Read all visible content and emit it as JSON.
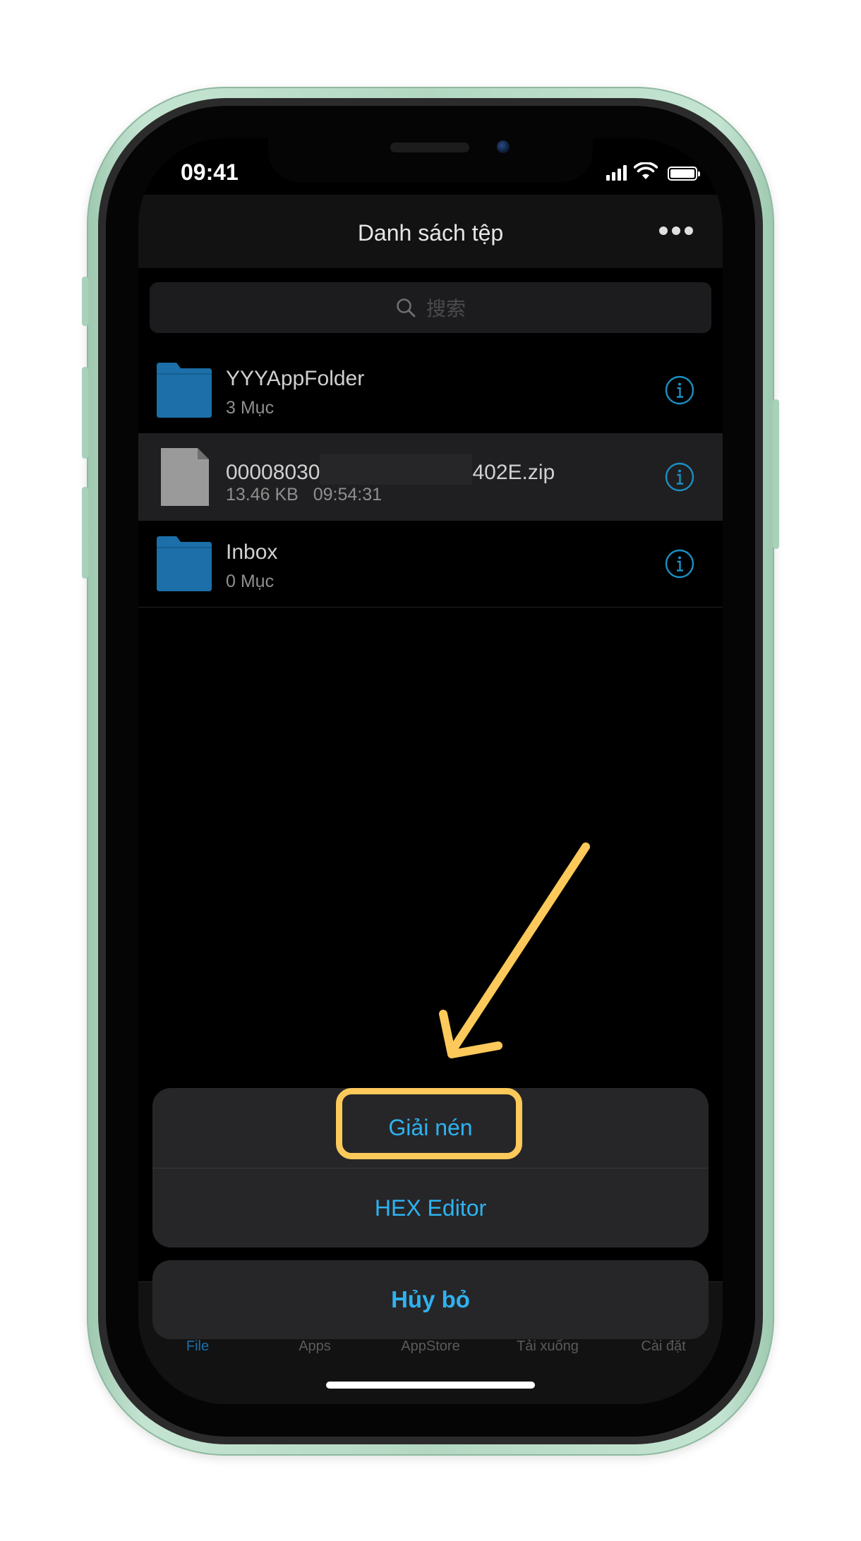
{
  "status_bar": {
    "time": "09:41",
    "signal_icon": "cellular-signal-icon",
    "wifi_icon": "wifi-icon",
    "battery_icon": "battery-icon"
  },
  "nav": {
    "title": "Danh sách tệp",
    "more_icon": "ellipsis-icon"
  },
  "search": {
    "placeholder": "搜索",
    "icon": "search-icon"
  },
  "files": [
    {
      "name": "YYYAppFolder",
      "meta": "3 Mục",
      "type": "folder",
      "selected": false
    },
    {
      "name_start": "00008030",
      "name_end": "402E.zip",
      "size": "13.46 KB",
      "time": "09:54:31",
      "type": "file",
      "selected": true
    },
    {
      "name": "Inbox",
      "meta": "0 Mục",
      "type": "folder",
      "selected": false
    }
  ],
  "tabs": [
    {
      "label": "File",
      "active": true
    },
    {
      "label": "Apps",
      "active": false
    },
    {
      "label": "AppStore",
      "active": false
    },
    {
      "label": "Tải xuống",
      "active": false
    },
    {
      "label": "Cài đặt",
      "active": false
    }
  ],
  "action_sheet": {
    "actions": [
      "Giải nén",
      "HEX Editor"
    ],
    "cancel": "Hủy bỏ"
  },
  "colors": {
    "accent": "#2fb2f0",
    "folder": "#1c6fa8",
    "annotation": "#fcc95a",
    "frame": "#b3d8c2"
  }
}
